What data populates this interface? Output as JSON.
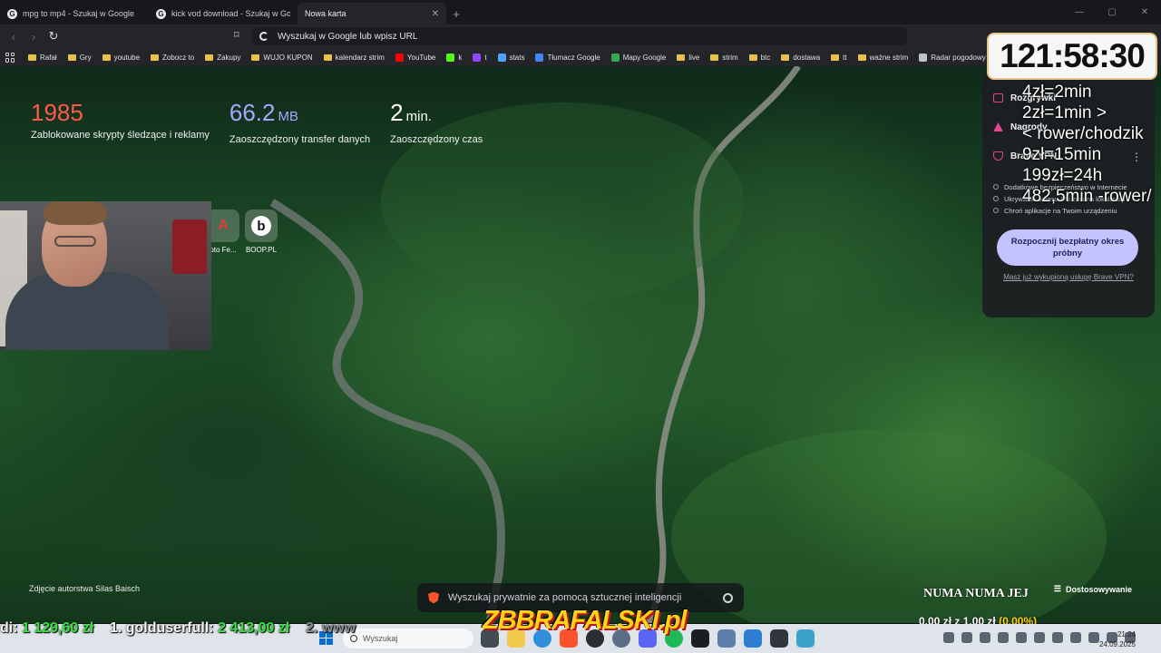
{
  "browser": {
    "tabs": [
      {
        "label": "mpg to mp4 - Szukaj w Google",
        "active": false
      },
      {
        "label": "kick vod download - Szukaj w Google",
        "active": false
      },
      {
        "label": "Nowa karta",
        "active": true
      }
    ],
    "address_placeholder": "Wyszukaj w Google lub wpisz URL",
    "bookmarks": [
      {
        "label": "Rafał",
        "icon": "folder-icon"
      },
      {
        "label": "Gry",
        "icon": "folder-icon"
      },
      {
        "label": "youtube",
        "icon": "folder-icon"
      },
      {
        "label": "Zobocz to",
        "icon": "folder-icon"
      },
      {
        "label": "Zakupy",
        "icon": "folder-icon"
      },
      {
        "label": "WUJO KUPON",
        "icon": "folder-icon"
      },
      {
        "label": "kalendarz strim",
        "icon": "folder-icon"
      },
      {
        "label": "YouTube",
        "icon": "youtube-icon"
      },
      {
        "label": "k",
        "icon": "kick-icon"
      },
      {
        "label": "t",
        "icon": "twitch-icon"
      },
      {
        "label": "stats",
        "icon": "stats-icon"
      },
      {
        "label": "Tłumacz Google",
        "icon": "translate-icon"
      },
      {
        "label": "Mapy Google",
        "icon": "maps-icon"
      },
      {
        "label": "live",
        "icon": "folder-icon"
      },
      {
        "label": "strim",
        "icon": "folder-icon"
      },
      {
        "label": "btc",
        "icon": "folder-icon"
      },
      {
        "label": "dostawa",
        "icon": "folder-icon"
      },
      {
        "label": "tt",
        "icon": "folder-icon"
      },
      {
        "label": "ważne strim",
        "icon": "folder-icon"
      },
      {
        "label": "Radar pogodowy",
        "icon": "radar-icon"
      }
    ]
  },
  "stats": [
    {
      "value": "1985",
      "unit": "",
      "label": "Zablokowane skrypty śledzące i reklamy",
      "color": "#ff5a4a"
    },
    {
      "value": "66.2",
      "unit": "MB",
      "label": "Zaoszczędzony transfer danych",
      "color": "#a7a6ff"
    },
    {
      "value": "2",
      "unit": "min.",
      "label": "Zaoszczędzony czas",
      "color": "#ffffff"
    }
  ],
  "top_sites": [
    {
      "label": "oto Fe..."
    },
    {
      "label": "BOOP.PL"
    }
  ],
  "photo_credit": "Zdjęcie autorstwa Silas Baisch",
  "ai_search_placeholder": "Wyszukaj prywatnie za pomocą sztucznej inteligencji",
  "customize_label": "Dostosowywanie",
  "panel": {
    "rows": [
      "Rozgrywki",
      "Nagrody",
      "Brave VPN"
    ],
    "bullets": [
      "Dodatkowe bezpieczeństwo w Internecie",
      "Ukrywanie adresu IP i zmiana lokalizacji",
      "Chroń aplikacje na Twoim urządzeniu"
    ],
    "trial_button": "Rozpocznij bezpłatny okres próbny",
    "bought_link": "Masz już wykupioną usługę Brave VPN?"
  },
  "overlay": {
    "timer": "121:58:30",
    "prices": "4zł=2min\n2zł=1min >\n< rower/chodzik\n9zł=15min\n199zł=24h\n482,5min -rower/",
    "ticker_prefix": "di:",
    "ticker_amount1": "1 129,60 zł",
    "ticker_user": "1. golduserfull:",
    "ticker_amount2": "2 413,00 zł",
    "ticker_next": "2. www",
    "brand": "ZBBRAFALSKI.pl",
    "song": "NUMA NUMA JEJ",
    "donation_amount": "0.00 zł",
    "donation_sep": "z",
    "donation_goal": "1.00 zł",
    "donation_pct": "(0.00%)"
  },
  "taskbar": {
    "search_placeholder": "Wyszukaj",
    "time": "21:24",
    "date": "24.09.2025"
  }
}
